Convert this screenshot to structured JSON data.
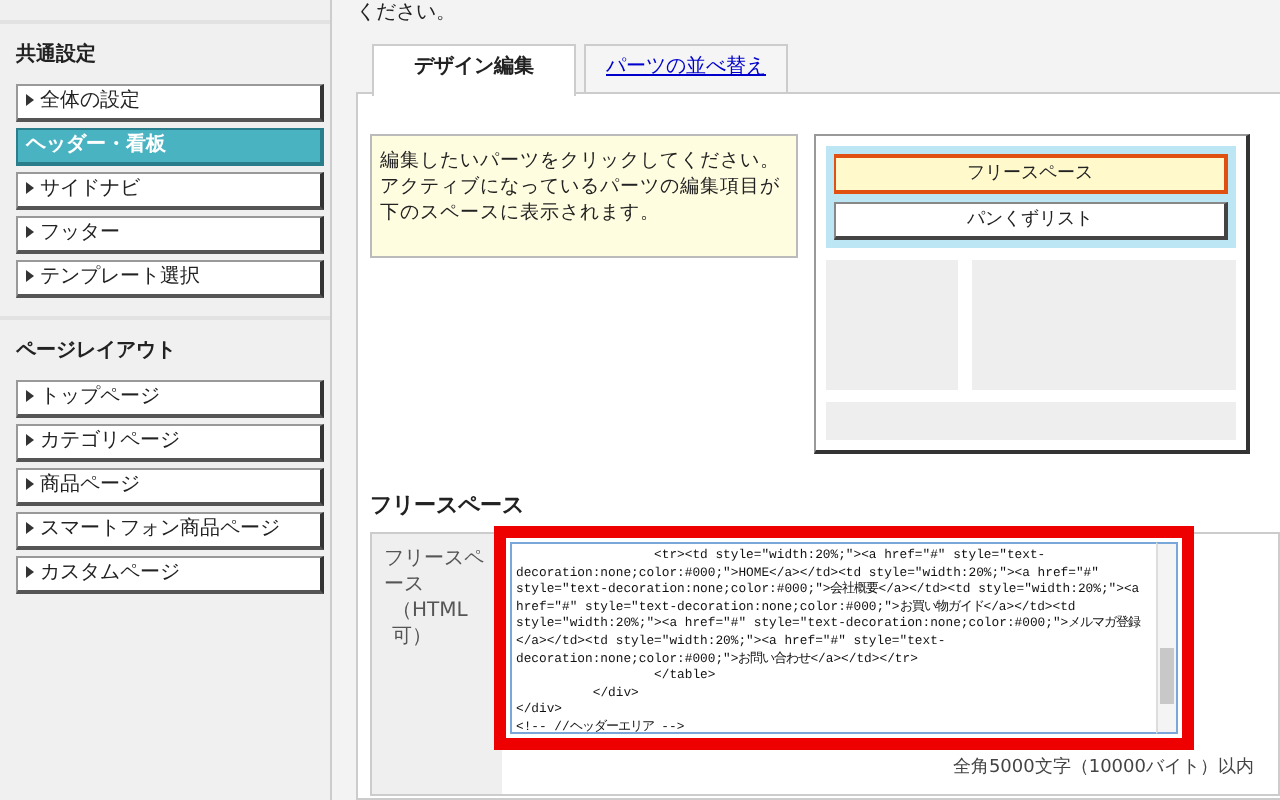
{
  "sidebar": {
    "sections": [
      {
        "title": "共通設定",
        "items": [
          {
            "label": "全体の設定",
            "selected": false
          },
          {
            "label": "ヘッダー・看板",
            "selected": true
          },
          {
            "label": "サイドナビ",
            "selected": false
          },
          {
            "label": "フッター",
            "selected": false
          },
          {
            "label": "テンプレート選択",
            "selected": false
          }
        ]
      },
      {
        "title": "ページレイアウト",
        "items": [
          {
            "label": "トップページ",
            "selected": false
          },
          {
            "label": "カテゴリページ",
            "selected": false
          },
          {
            "label": "商品ページ",
            "selected": false
          },
          {
            "label": "スマートフォン商品ページ",
            "selected": false
          },
          {
            "label": "カスタムページ",
            "selected": false
          }
        ]
      }
    ]
  },
  "intro_text": "ください。",
  "tabs": [
    {
      "label": "デザイン編集",
      "selected": true
    },
    {
      "label": "パーツの並べ替え",
      "selected": false
    }
  ],
  "hint": {
    "lines": [
      "編集したいパーツをクリックしてください。",
      "アクティブになっているパーツの編集項目が下のスペースに表示されます。"
    ]
  },
  "preview": {
    "parts": [
      {
        "label": "フリースペース",
        "selected": true
      },
      {
        "label": "パンくずリスト",
        "selected": false
      }
    ]
  },
  "section_title": "フリースペース",
  "form": {
    "label": "フリースペース",
    "sublabel": "（HTML可）",
    "value": "                  <tr><td style=\"width:20%;\"><a href=\"#\" style=\"text-decoration:none;color:#000;\">HOME</a></td><td style=\"width:20%;\"><a href=\"#\" style=\"text-decoration:none;color:#000;\">会社概要</a></td><td style=\"width:20%;\"><a href=\"#\" style=\"text-decoration:none;color:#000;\">お買い物ガイド</a></td><td style=\"width:20%;\"><a href=\"#\" style=\"text-decoration:none;color:#000;\">メルマガ登録</a></td><td style=\"width:20%;\"><a href=\"#\" style=\"text-decoration:none;color:#000;\">お問い合わせ</a></td></tr>\n                  </table>\n          </div>\n</div>\n<!-- //ヘッダーエリア -->",
    "note": "全角5000文字（10000バイト）以内"
  }
}
